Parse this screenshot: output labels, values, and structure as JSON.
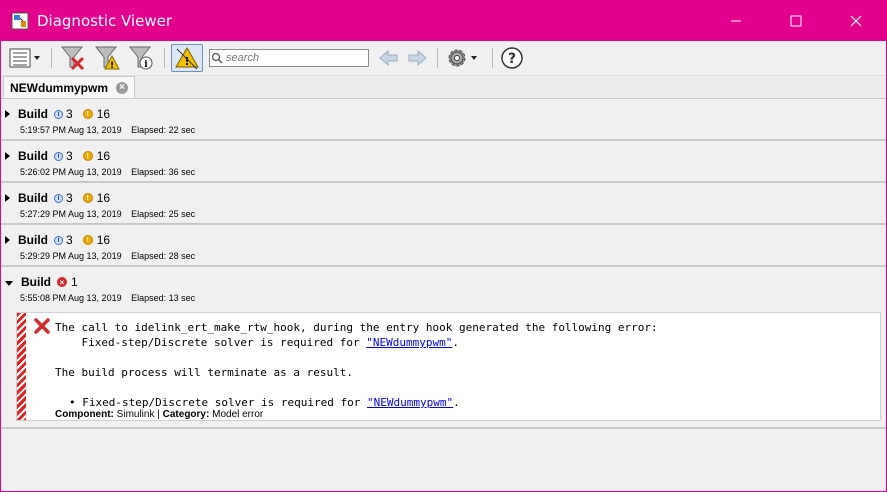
{
  "window": {
    "title": "Diagnostic Viewer",
    "accent_color": "#e3008c",
    "controls": [
      "minimize-icon",
      "maximize-icon",
      "close-icon"
    ]
  },
  "toolbar": {
    "search_placeholder": "search",
    "buttons": [
      "list-view-icon",
      "filter-errors-icon",
      "filter-warnings-icon",
      "filter-info-icon",
      "warning-toggle-icon",
      "back-arrow-icon",
      "forward-arrow-icon",
      "settings-gear-icon",
      "help-icon"
    ]
  },
  "tab": {
    "label": "NEWdummypwm"
  },
  "builds": [
    {
      "label": "Build",
      "info_count": "3",
      "warn_count": "16",
      "timestamp": "5:19:57 PM Aug 13, 2019",
      "elapsed": "Elapsed: 22 sec"
    },
    {
      "label": "Build",
      "info_count": "3",
      "warn_count": "16",
      "timestamp": "5:26:02 PM Aug 13, 2019",
      "elapsed": "Elapsed: 36 sec"
    },
    {
      "label": "Build",
      "info_count": "3",
      "warn_count": "16",
      "timestamp": "5:27:29 PM Aug 13, 2019",
      "elapsed": "Elapsed: 25 sec"
    },
    {
      "label": "Build",
      "info_count": "3",
      "warn_count": "16",
      "timestamp": "5:29:29 PM Aug 13, 2019",
      "elapsed": "Elapsed: 28 sec"
    }
  ],
  "expanded_build": {
    "label": "Build",
    "error_count": "1",
    "timestamp": "5:55:08 PM Aug 13, 2019",
    "elapsed": "Elapsed: 13 sec",
    "error": {
      "line1": "The call to idelink_ert_make_rtw_hook, during the entry hook generated the following error:",
      "line2_prefix": "    Fixed-step/Discrete solver is required for ",
      "line2_link": "\"NEWdummypwm\"",
      "line2_suffix": ".",
      "line3": "The build process will terminate as a result.",
      "bullet_prefix": "Fixed-step/Discrete solver is required for ",
      "bullet_link": "\"NEWdummypwm\"",
      "bullet_suffix": ".",
      "component_label": "Component:",
      "component_value": "Simulink",
      "separator": "|",
      "category_label": "Category:",
      "category_value": "Model error"
    }
  }
}
